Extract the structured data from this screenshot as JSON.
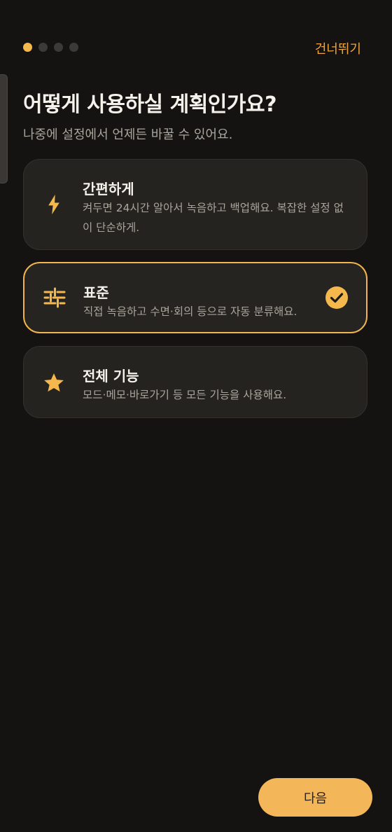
{
  "header": {
    "step_total": 4,
    "step_current": 1,
    "skip_label": "건너뛰기"
  },
  "title": "어떻게 사용하실 계획인가요?",
  "subtitle": "나중에 설정에서 언제든 바꿀 수 있어요.",
  "options": [
    {
      "title": "간편하게",
      "description": "켜두면 24시간 알아서 녹음하고 백업해요. 복잡한 설정 없이 단순하게.",
      "icon": "lightning-icon",
      "selected": false
    },
    {
      "title": "표준",
      "description": "직접 녹음하고 수면·회의 등으로 자동 분류해요.",
      "icon": "sliders-icon",
      "selected": true
    },
    {
      "title": "전체 기능",
      "description": "모드·메모·바로가기 등 모든 기능을 사용해요.",
      "icon": "star-icon",
      "selected": false
    }
  ],
  "next_label": "다음",
  "colors": {
    "background": "#141311",
    "accent": "#f5b84c",
    "card": "#252320",
    "text_secondary": "#aaa59c"
  }
}
